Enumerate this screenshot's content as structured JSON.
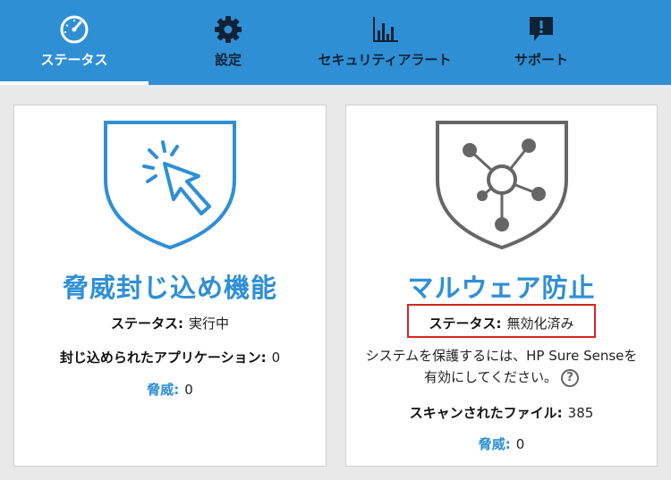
{
  "nav": {
    "tabs": [
      {
        "label": "ステータス",
        "icon": "speedometer-icon",
        "active": true
      },
      {
        "label": "設定",
        "icon": "gear-icon",
        "active": false
      },
      {
        "label": "セキュリティアラート",
        "icon": "bar-chart-icon",
        "active": false
      },
      {
        "label": "サポート",
        "icon": "alert-chat-icon",
        "active": false
      }
    ]
  },
  "colors": {
    "accent": "#2f8fd4",
    "title_blue": "#2e8fd6",
    "highlight_red": "#d8261e",
    "icon_dark": "#0f2235",
    "shield_gray": "#666666"
  },
  "threat_containment": {
    "title": "脅威封じ込め機能",
    "status_label": "ステータス:",
    "status_value": "実行中",
    "contained_label": "封じ込められたアプリケーション:",
    "contained_value": "0",
    "threats_label": "脅威:",
    "threats_value": "0",
    "icon": "cursor-shield-icon"
  },
  "malware_protection": {
    "title": "マルウェア防止",
    "status_label": "ステータス:",
    "status_value": "無効化済み",
    "message_line1": "システムを保護するには、HP Sure Senseを",
    "message_line2": "有効にしてください。",
    "help_glyph": "?",
    "scanned_label": "スキャンされたファイル:",
    "scanned_value": "385",
    "threats_label": "脅威:",
    "threats_value": "0",
    "icon": "network-shield-icon"
  }
}
